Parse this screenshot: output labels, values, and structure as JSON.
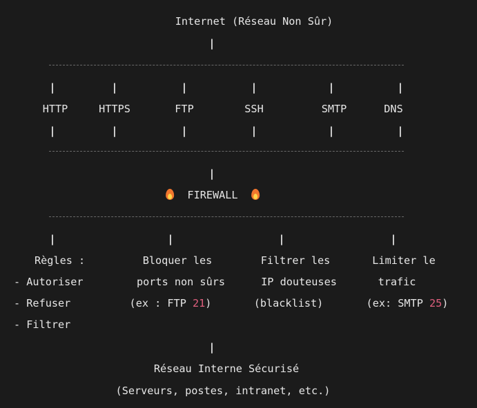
{
  "title": "Internet (Réseau Non Sûr)",
  "pipe": "|",
  "protocols": [
    "HTTP",
    "HTTPS",
    "FTP",
    "SSH",
    "SMTP",
    "DNS"
  ],
  "firewall": {
    "label": "FIREWALL",
    "icon": "fire-icon",
    "icon_color": "#f2762e"
  },
  "rules": {
    "heading": "Règles :",
    "items": [
      "- Autoriser",
      "- Refuser",
      "- Filtrer"
    ]
  },
  "block_ports": {
    "line1": "Bloquer les",
    "line2": "ports non sûrs",
    "prefix": "(ex : FTP ",
    "number": "21",
    "suffix": ")"
  },
  "filter_ip": {
    "line1": "Filtrer les",
    "line2": "IP douteuses",
    "line3": "(blacklist)"
  },
  "limit_traffic": {
    "line1": "Limiter le",
    "line2": "trafic",
    "prefix": "(ex: SMTP ",
    "number": "25",
    "suffix": ")"
  },
  "internal": {
    "title": "Réseau Interne Sécurisé",
    "subtitle": "(Serveurs, postes, intranet, etc.)"
  },
  "colors": {
    "background": "#1b1b1b",
    "text": "#e6e6e6",
    "number_highlight": "#e0607e",
    "dashes": "#6a6a6a"
  }
}
